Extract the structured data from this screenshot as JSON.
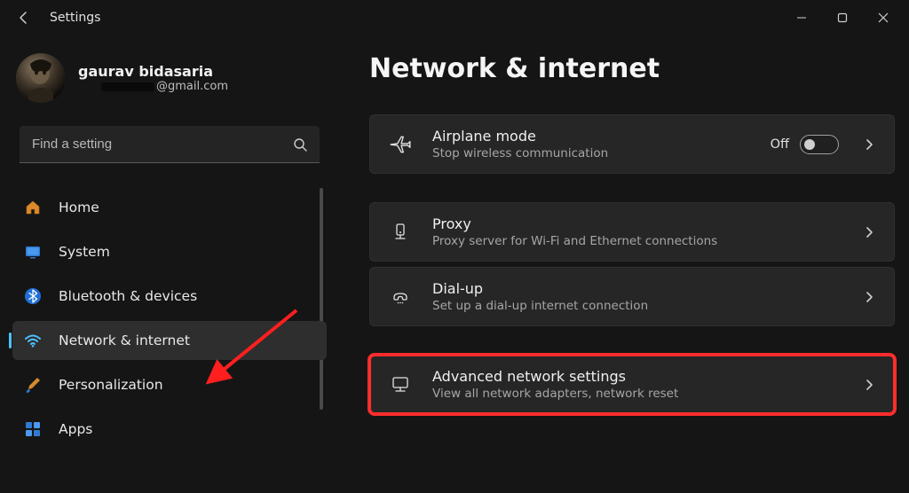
{
  "window": {
    "title": "Settings"
  },
  "user": {
    "name": "gaurav bidasaria",
    "email_suffix": "@gmail.com"
  },
  "search": {
    "placeholder": "Find a setting"
  },
  "nav": {
    "items": [
      {
        "id": "home",
        "label": "Home"
      },
      {
        "id": "system",
        "label": "System"
      },
      {
        "id": "bluetooth",
        "label": "Bluetooth & devices"
      },
      {
        "id": "network",
        "label": "Network & internet"
      },
      {
        "id": "personalization",
        "label": "Personalization"
      },
      {
        "id": "apps",
        "label": "Apps"
      }
    ],
    "selected": "network"
  },
  "page": {
    "title": "Network & internet",
    "cards": {
      "airplane": {
        "title": "Airplane mode",
        "subtitle": "Stop wireless communication",
        "toggle_label": "Off",
        "toggle_state": "off"
      },
      "proxy": {
        "title": "Proxy",
        "subtitle": "Proxy server for Wi-Fi and Ethernet connections"
      },
      "dialup": {
        "title": "Dial-up",
        "subtitle": "Set up a dial-up internet connection"
      },
      "advanced": {
        "title": "Advanced network settings",
        "subtitle": "View all network adapters, network reset"
      }
    }
  }
}
